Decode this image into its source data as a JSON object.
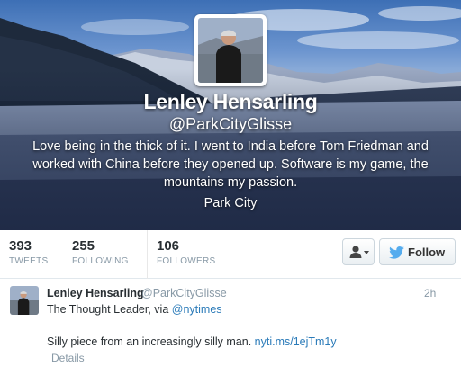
{
  "profile": {
    "name": "Lenley Hensarling",
    "handle": "@ParkCityGlisse",
    "bio": "Love being in the thick of it. I went to India before Tom Friedman and worked with China before they opened up. Software is my game, the mountains my passion.",
    "location": "Park City"
  },
  "stats": [
    {
      "value": "393",
      "label": "TWEETS"
    },
    {
      "value": "255",
      "label": "FOLLOWING"
    },
    {
      "value": "106",
      "label": "FOLLOWERS"
    }
  ],
  "actions": {
    "user_menu_icon": "user-dropdown-icon",
    "follow_label": "Follow",
    "follow_icon": "twitter-bird-icon"
  },
  "tweet": {
    "author_name": "Lenley Hensarling",
    "author_handle": "@ParkCityGlisse",
    "time": "2h",
    "line1_text": "The Thought Leader, via ",
    "line1_mention": "@nytimes",
    "line2_text": "Silly piece from an increasingly silly man. ",
    "line2_link": "nyti.ms/1ejTm1y",
    "details_label": "Details"
  },
  "colors": {
    "link": "#2b7bb9",
    "muted": "#8899a6",
    "text": "#292f33",
    "twitter_blue": "#55acee"
  }
}
